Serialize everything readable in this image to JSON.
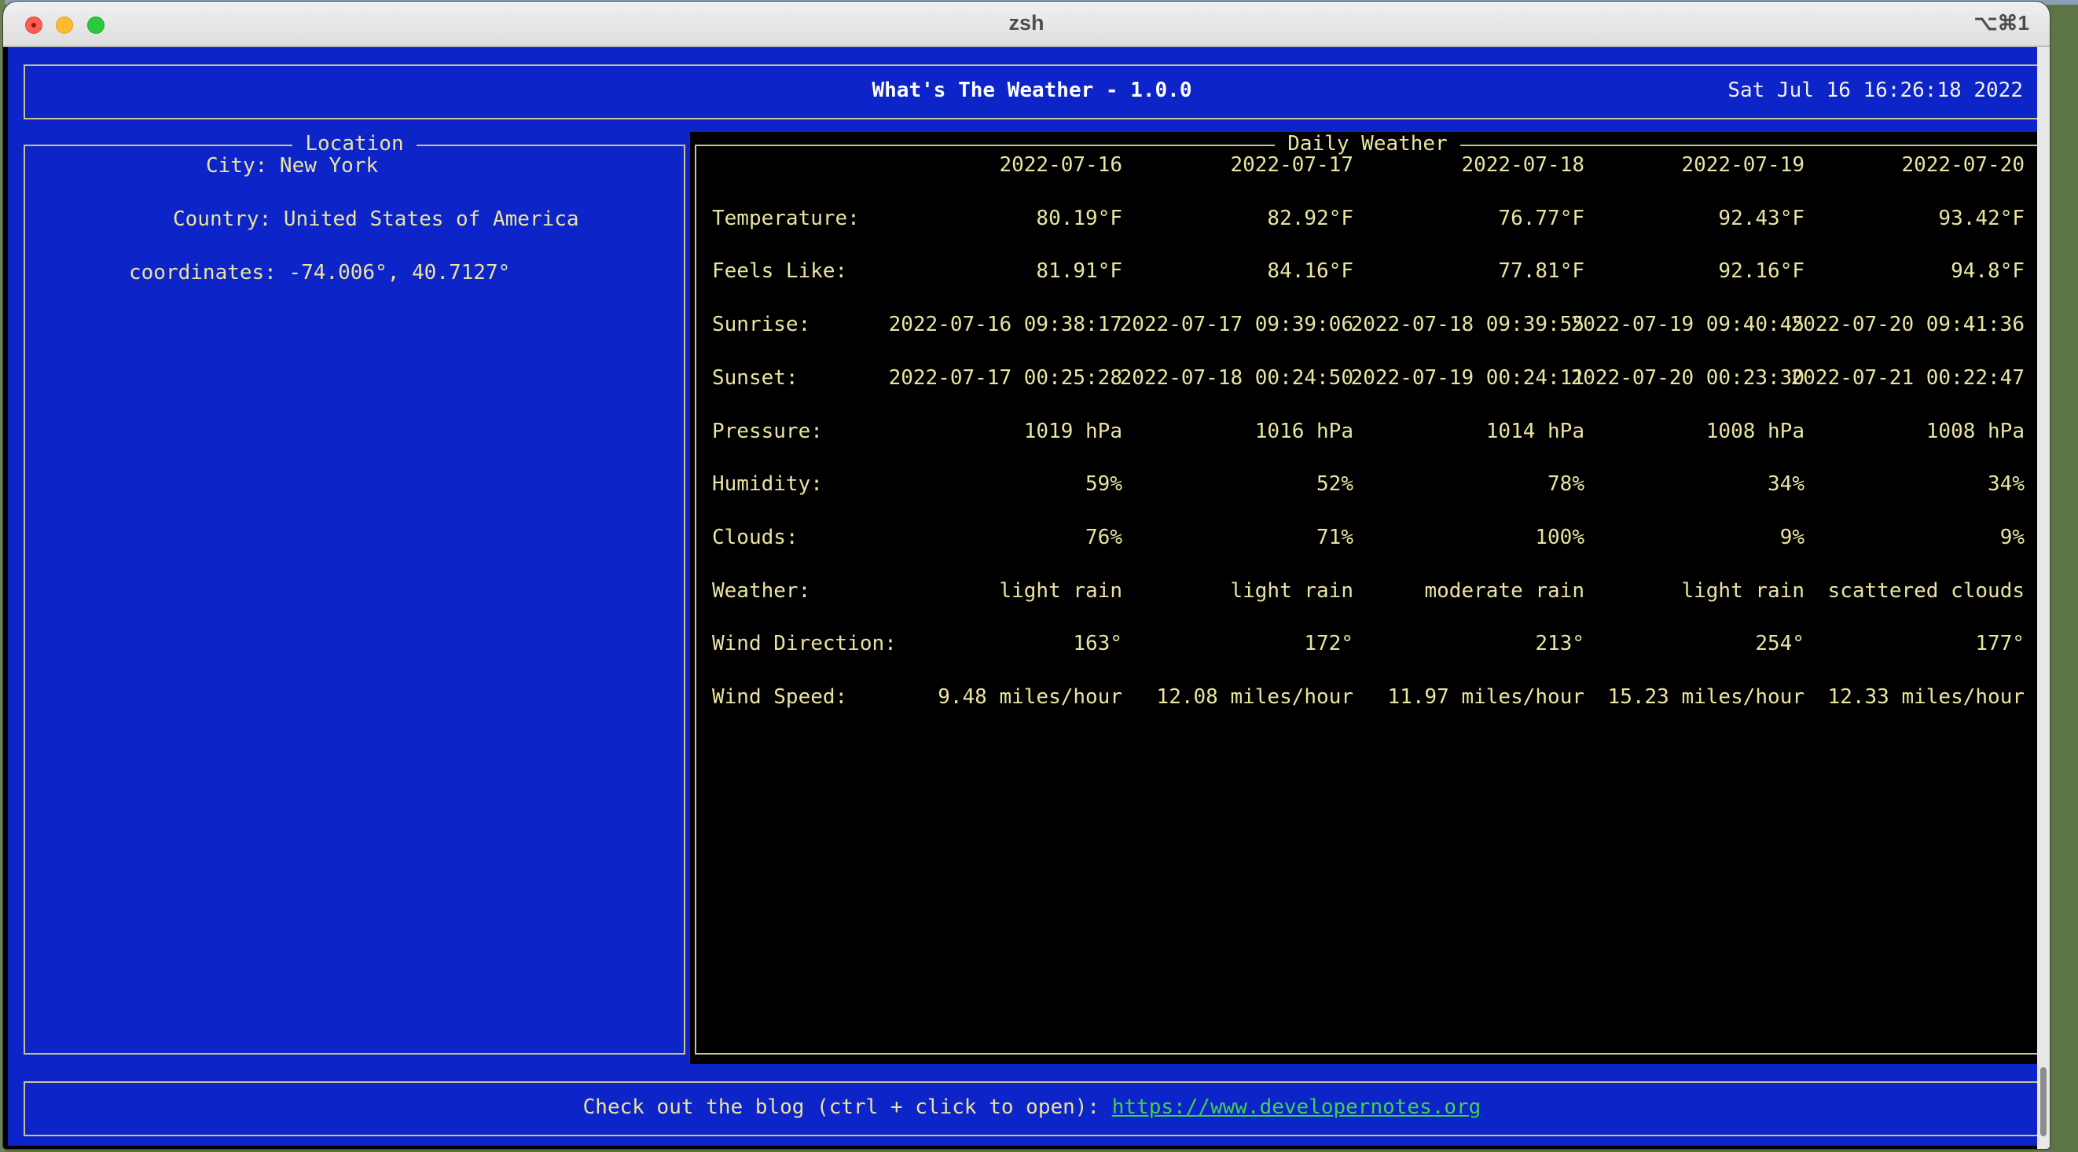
{
  "window": {
    "title": "zsh",
    "shortcut": "⌥⌘1"
  },
  "header": {
    "title": "What's The Weather - 1.0.0",
    "datetime": "Sat Jul 16 16:26:18 2022"
  },
  "location": {
    "title": "Location",
    "city": "City: New York",
    "country": "Country: United States of America",
    "coordinates": "coordinates: -74.006°, 40.7127°"
  },
  "daily": {
    "title": "Daily Weather",
    "dates": [
      "2022-07-16",
      "2022-07-17",
      "2022-07-18",
      "2022-07-19",
      "2022-07-20"
    ],
    "rows": [
      {
        "label": "Temperature:",
        "values": [
          "80.19°F",
          "82.92°F",
          "76.77°F",
          "92.43°F",
          "93.42°F"
        ]
      },
      {
        "label": "Feels Like:",
        "values": [
          "81.91°F",
          "84.16°F",
          "77.81°F",
          "92.16°F",
          "94.8°F"
        ]
      },
      {
        "label": "Sunrise:",
        "values": [
          "2022-07-16 09:38:17",
          "2022-07-17 09:39:06",
          "2022-07-18 09:39:55",
          "2022-07-19 09:40:45",
          "2022-07-20 09:41:36"
        ]
      },
      {
        "label": "Sunset:",
        "values": [
          "2022-07-17 00:25:28",
          "2022-07-18 00:24:50",
          "2022-07-19 00:24:11",
          "2022-07-20 00:23:30",
          "2022-07-21 00:22:47"
        ]
      },
      {
        "label": "Pressure:",
        "values": [
          "1019 hPa",
          "1016 hPa",
          "1014 hPa",
          "1008 hPa",
          "1008 hPa"
        ]
      },
      {
        "label": "Humidity:",
        "values": [
          "59%",
          "52%",
          "78%",
          "34%",
          "34%"
        ]
      },
      {
        "label": "Clouds:",
        "values": [
          "76%",
          "71%",
          "100%",
          "9%",
          "9%"
        ]
      },
      {
        "label": "Weather:",
        "values": [
          "light rain",
          "light rain",
          "moderate rain",
          "light rain",
          "scattered clouds"
        ]
      },
      {
        "label": "Wind Direction:",
        "values": [
          "163°",
          "172°",
          "213°",
          "254°",
          "177°"
        ]
      },
      {
        "label": "Wind Speed:",
        "values": [
          "9.48 miles/hour",
          "12.08 miles/hour",
          "11.97 miles/hour",
          "15.23 miles/hour",
          "12.33 miles/hour"
        ]
      }
    ]
  },
  "footer": {
    "text": "Check out the blog (ctrl + click to open): ",
    "link": "https://www.developernotes.org"
  }
}
